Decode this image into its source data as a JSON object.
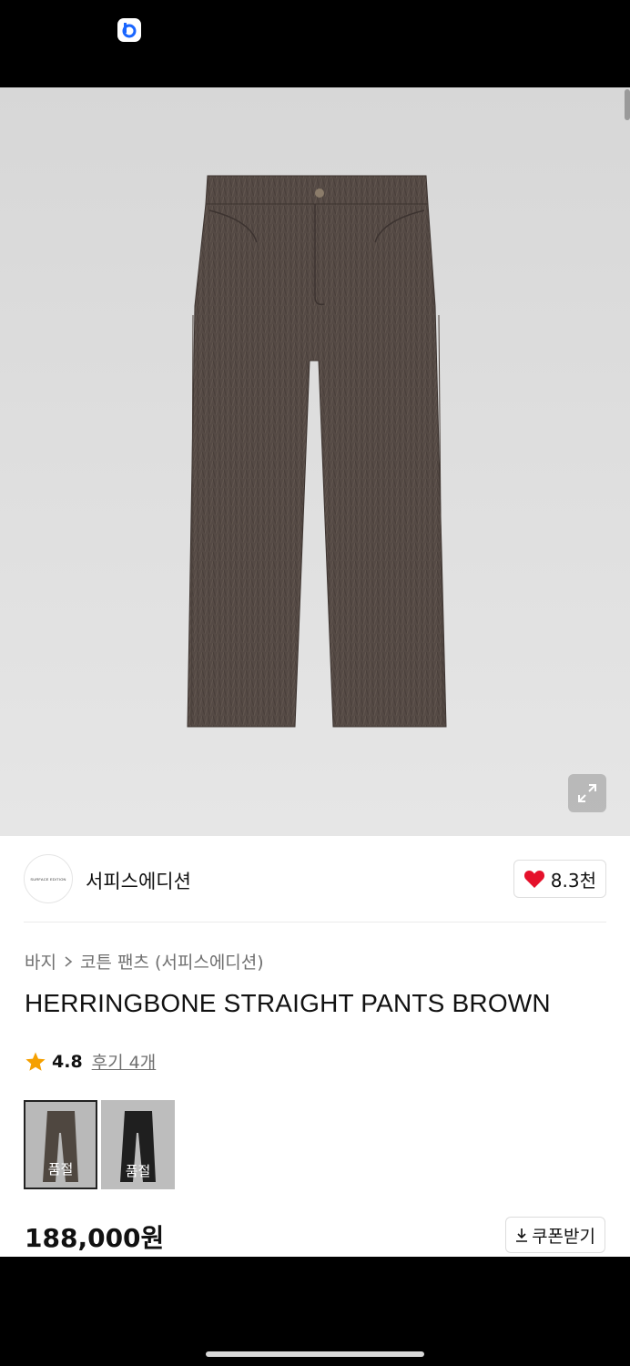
{
  "status_bar": {
    "app_badge_icon": "b-app-icon",
    "badge_color": "#1a66ff"
  },
  "product_image": {
    "alt": "",
    "expand_icon": "expand-arrows-icon"
  },
  "brand": {
    "logo_text": "SURFACE EDITION",
    "name": "서피스에디션",
    "like_icon": "heart-icon",
    "like_count": "8.3천",
    "heart_color": "#e5112b"
  },
  "breadcrumb": {
    "category": "바지",
    "separator_icon": "chevron-right-icon",
    "subcategory": "코튼 팬츠 (서피스에디션)"
  },
  "product": {
    "title": "HERRINGBONE STRAIGHT PANTS BROWN",
    "rating_icon": "star-icon",
    "star_color": "#f5a000",
    "rating": "4.8",
    "reviews_label": "후기 4개",
    "price": "188,000원"
  },
  "options": [
    {
      "color_name": "brown",
      "status": "품절",
      "selected": true
    },
    {
      "color_name": "black",
      "status": "품절",
      "selected": false
    }
  ],
  "coupon": {
    "icon": "download-icon",
    "label": "쿠폰받기"
  }
}
